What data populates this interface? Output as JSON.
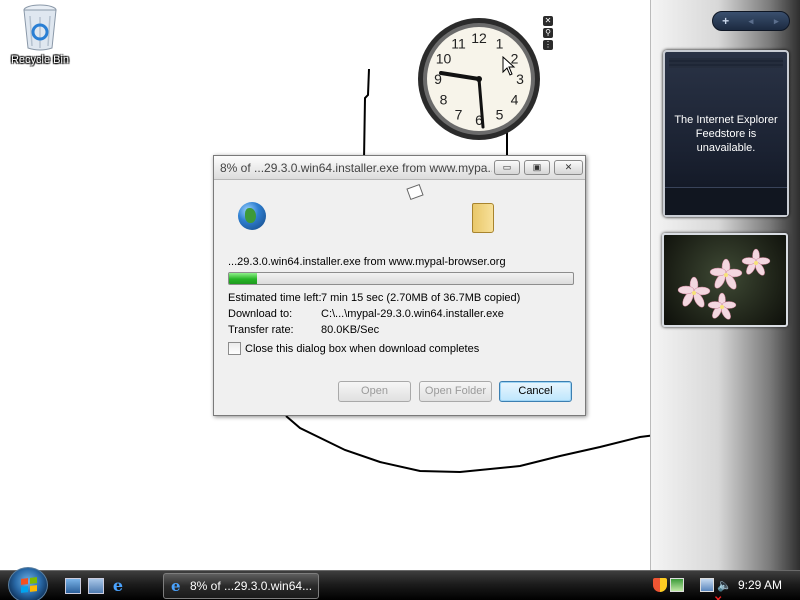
{
  "desktop": {
    "recycle_bin_label": "Recycle Bin",
    "icons": [
      "recycle-bin-icon"
    ]
  },
  "clock": {
    "numerals": [
      "12",
      "1",
      "2",
      "3",
      "4",
      "5",
      "6",
      "7",
      "8",
      "9",
      "10",
      "11"
    ],
    "time_shown": "9:29"
  },
  "sidebar": {
    "add_label": "+",
    "prev_label": "◂",
    "next_label": "▸",
    "feed_message": "The Internet Explorer Feedstore is unavailable."
  },
  "dialog": {
    "title": "8% of ...29.3.0.win64.installer.exe from www.mypa...",
    "minimize_glyph": "▭",
    "maximize_glyph": "▣",
    "close_glyph": "✕",
    "filename_line": "...29.3.0.win64.installer.exe from www.mypal-browser.org",
    "progress_percent": 8,
    "rows": [
      {
        "label": "Estimated time left:",
        "value": "7 min 15 sec (2.70MB of 36.7MB copied)"
      },
      {
        "label": "Download to:",
        "value": "C:\\...\\mypal-29.3.0.win64.installer.exe"
      },
      {
        "label": "Transfer rate:",
        "value": "80.0KB/Sec"
      }
    ],
    "close_when_complete_label": "Close this dialog box when download completes",
    "close_when_complete_checked": false,
    "buttons": {
      "open": "Open",
      "open_folder": "Open Folder",
      "cancel": "Cancel"
    },
    "accent_color": "#27b527"
  },
  "taskbar": {
    "task_button_label": "8% of ...29.3.0.win64...",
    "time": "9:29 AM"
  }
}
